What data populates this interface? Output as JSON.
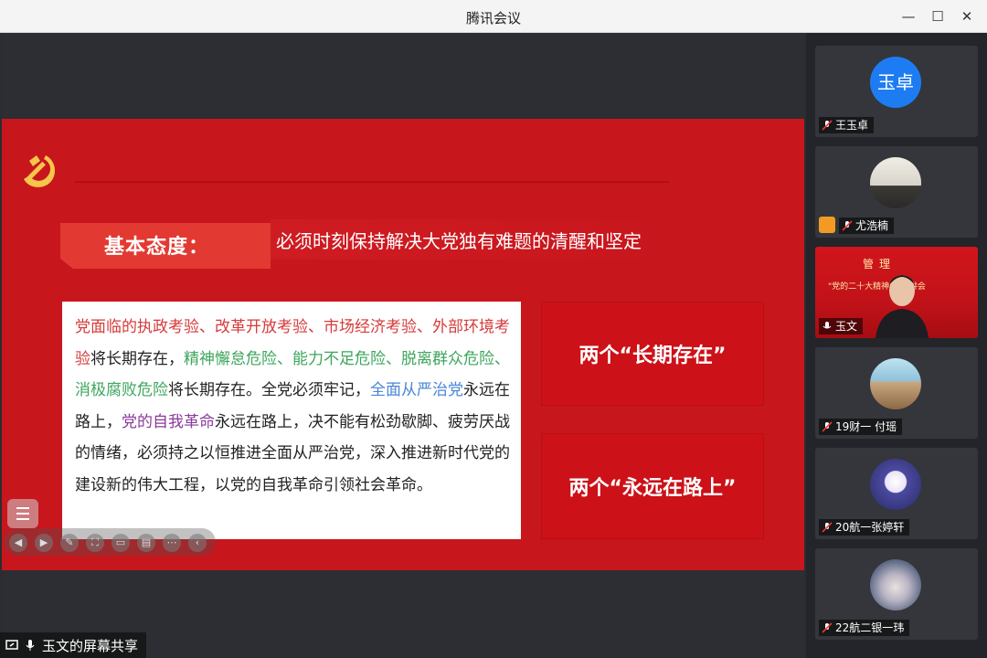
{
  "window": {
    "title": "腾讯会议",
    "minimize": "—",
    "maximize": "☐",
    "close": "✕"
  },
  "slide": {
    "ribbon_label": "基本态度：",
    "headline": "必须时刻保持解决大党独有难题的清醒和坚定",
    "body_segments": [
      {
        "text": "党面临的执政考验、改革开放考验、市场经济考验、外部环境考验",
        "color": "red"
      },
      {
        "text": "将长期存在，",
        "color": "black"
      },
      {
        "text": "精神懈怠危险、能力不足危险、脱离群众危险、消极腐败危险",
        "color": "green"
      },
      {
        "text": "将长期存在。全党必须牢记，",
        "color": "black"
      },
      {
        "text": "全面从严治党",
        "color": "blue"
      },
      {
        "text": "永远在路上，",
        "color": "black"
      },
      {
        "text": "党的自我革命",
        "color": "purple"
      },
      {
        "text": "永远在路上，决不能有松劲歇脚、疲劳厌战的情绪，必须持之以恒推进全面从严治党，深入推进新时代党的建设新的伟大工程，以党的自我革命引领社会革命。",
        "color": "black"
      }
    ],
    "box1": "两个“长期存在”",
    "box2": "两个“永远在路上”"
  },
  "share_label": "玉文的屏幕共享",
  "participants": [
    {
      "name": "王玉卓",
      "avatar_text": "玉卓",
      "muted": true
    },
    {
      "name": "尤浩楠",
      "muted": true,
      "host": true
    },
    {
      "name": "玉文",
      "muted": false,
      "video": true,
      "banner": "管理",
      "banner_sub": "\"党的二十大精神\"...宣讲会"
    },
    {
      "name": "19财一 付瑶",
      "muted": true
    },
    {
      "name": "20航一张婷轩",
      "muted": true
    },
    {
      "name": "22航二银一玮",
      "muted": true
    }
  ],
  "colors": {
    "slide_red": "#c8161d",
    "avatar_blue": "#1e7cf2",
    "red_text": "#d63a3a",
    "green_text": "#3da65c",
    "blue_text": "#4a86d6",
    "purple_text": "#8a3a9a"
  },
  "icons": [
    "minimize-icon",
    "maximize-icon",
    "close-icon",
    "party-emblem-icon",
    "menu-icon",
    "prev-icon",
    "next-icon",
    "pen-icon",
    "screenshot-icon",
    "screen-icon",
    "comment-icon",
    "more-icon",
    "collapse-icon",
    "mic-muted-icon",
    "mic-icon",
    "screen-share-icon",
    "host-icon"
  ]
}
